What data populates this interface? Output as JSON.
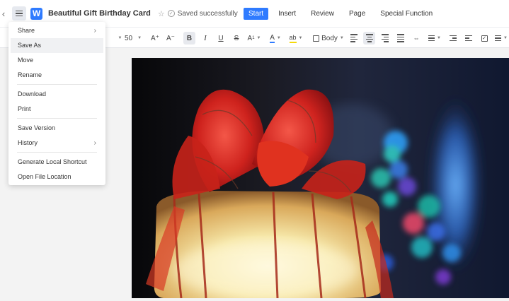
{
  "header": {
    "back_icon": "‹",
    "logo_letter": "W",
    "doc_title": "Beautiful Gift Birthday Card",
    "saved_status": "Saved successfully",
    "tabs": [
      {
        "label": "Start",
        "active": true
      },
      {
        "label": "Insert",
        "active": false
      },
      {
        "label": "Review",
        "active": false
      },
      {
        "label": "Page",
        "active": false
      },
      {
        "label": "Special Function",
        "active": false
      }
    ]
  },
  "toolbar": {
    "font_size": "50",
    "increase_font": "A⁺",
    "decrease_font": "A⁻",
    "bold": "B",
    "italic": "I",
    "underline": "U",
    "strikethrough": "S",
    "superscript": "A",
    "font_color": "A",
    "highlight": "ab",
    "paragraph_style": "Body",
    "accent_color": "#2f7bff",
    "font_color_value": "#2f7bff",
    "highlight_color_value": "#f5d90a"
  },
  "file_menu": {
    "items": [
      {
        "label": "Share",
        "has_submenu": true
      },
      {
        "label": "Save As",
        "has_submenu": false,
        "hovered": true
      },
      {
        "label": "Move",
        "has_submenu": false
      },
      {
        "label": "Rename",
        "has_submenu": false
      },
      {
        "label": "Download",
        "has_submenu": false
      },
      {
        "label": "Print",
        "has_submenu": false
      },
      {
        "label": "Save Version",
        "has_submenu": false
      },
      {
        "label": "History",
        "has_submenu": true
      },
      {
        "label": "Generate Local Shortcut",
        "has_submenu": false
      },
      {
        "label": "Open File Location",
        "has_submenu": false
      }
    ],
    "submenu_arrow": "›"
  }
}
